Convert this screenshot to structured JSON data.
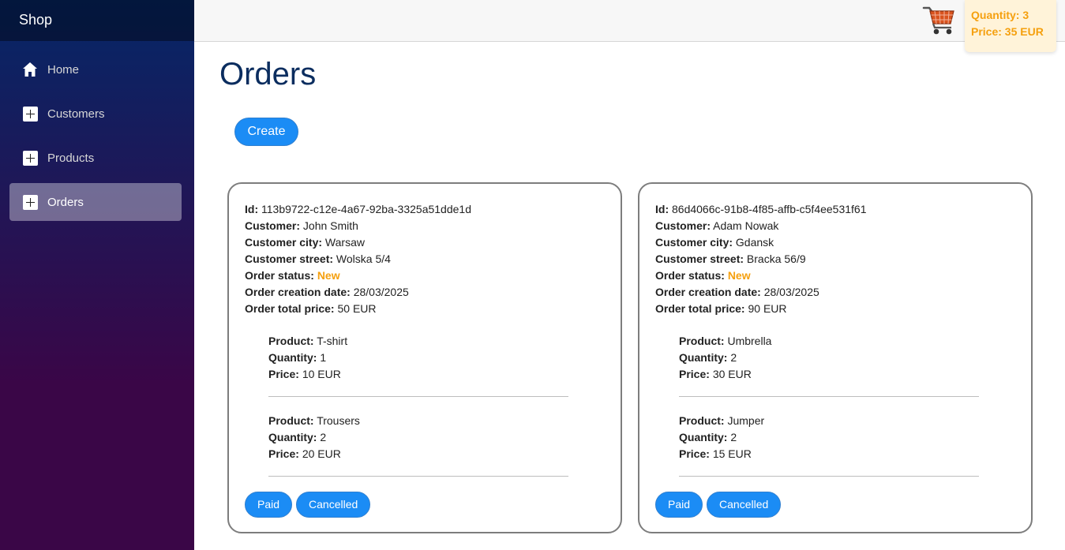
{
  "sidebar": {
    "brand": "Shop",
    "items": [
      {
        "label": "Home",
        "icon": "home-icon",
        "active": false
      },
      {
        "label": "Customers",
        "icon": "plus-icon",
        "active": false
      },
      {
        "label": "Products",
        "icon": "plus-icon",
        "active": false
      },
      {
        "label": "Orders",
        "icon": "plus-icon",
        "active": true
      }
    ]
  },
  "cart": {
    "icon": "shopping-cart-icon",
    "quantity_text": "Quantity: 3",
    "price_text": "Price: 35 EUR"
  },
  "main": {
    "title": "Orders",
    "create_label": "Create"
  },
  "labels": {
    "id": "Id:",
    "customer": "Customer:",
    "city": "Customer city:",
    "street": "Customer street:",
    "status": "Order status:",
    "created": "Order creation date:",
    "total": "Order total price:",
    "product": "Product:",
    "quantity": "Quantity:",
    "price": "Price:"
  },
  "orders": [
    {
      "id": "113b9722-c12e-4a67-92ba-3325a51dde1d",
      "customer": "John Smith",
      "city": "Warsaw",
      "street": "Wolska 5/4",
      "status": "New",
      "created": "28/03/2025",
      "total": "50 EUR",
      "products": [
        {
          "name": "T-shirt",
          "quantity": "1",
          "price": "10 EUR"
        },
        {
          "name": "Trousers",
          "quantity": "2",
          "price": "20 EUR"
        }
      ],
      "paid_label": "Paid",
      "cancelled_label": "Cancelled"
    },
    {
      "id": "86d4066c-91b8-4f85-affb-c5f4ee531f61",
      "customer": "Adam Nowak",
      "city": "Gdansk",
      "street": "Bracka 56/9",
      "status": "New",
      "created": "28/03/2025",
      "total": "90 EUR",
      "products": [
        {
          "name": "Umbrella",
          "quantity": "2",
          "price": "30 EUR"
        },
        {
          "name": "Jumper",
          "quantity": "2",
          "price": "15 EUR"
        }
      ],
      "paid_label": "Paid",
      "cancelled_label": "Cancelled"
    }
  ],
  "colors": {
    "accent": "#1b8cf5",
    "status_new": "#f5a00f",
    "title": "#0b2d5f"
  }
}
